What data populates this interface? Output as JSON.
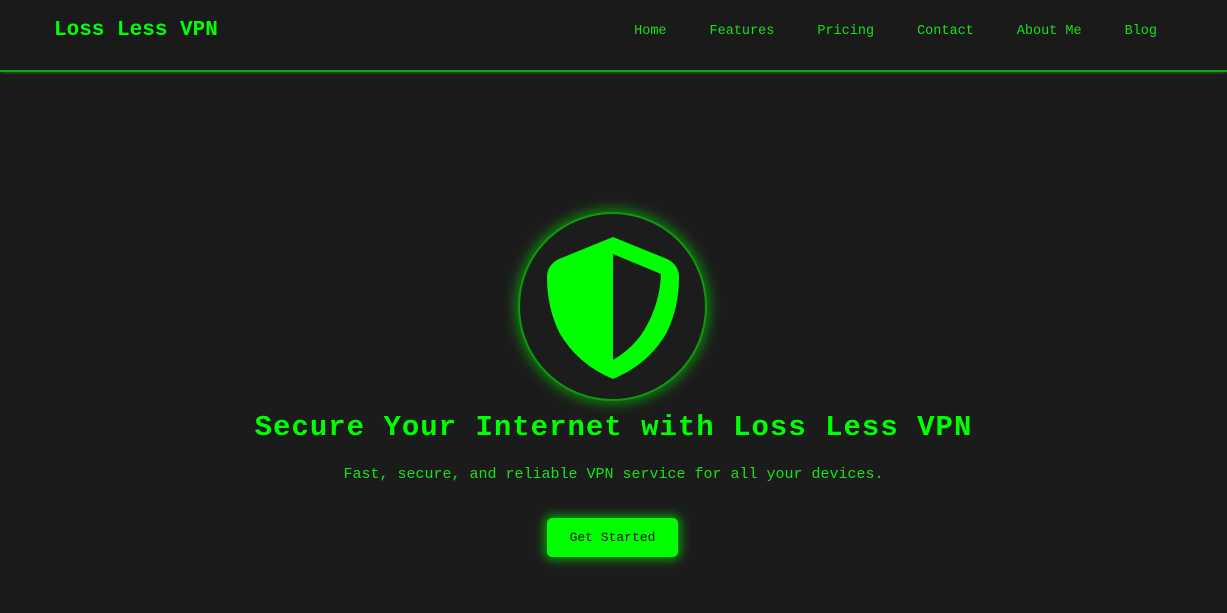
{
  "header": {
    "brand": "Loss Less VPN",
    "nav": [
      {
        "label": "Home"
      },
      {
        "label": "Features"
      },
      {
        "label": "Pricing"
      },
      {
        "label": "Contact"
      },
      {
        "label": "About Me"
      },
      {
        "label": "Blog"
      }
    ]
  },
  "hero": {
    "icon": "shield-icon",
    "title": "Secure Your Internet with Loss Less VPN",
    "subtitle": "Fast, secure, and reliable VPN service for all your devices.",
    "cta_label": "Get Started"
  },
  "colors": {
    "background": "#1b1b1b",
    "accent": "#00ff00",
    "button_text": "#111111"
  }
}
